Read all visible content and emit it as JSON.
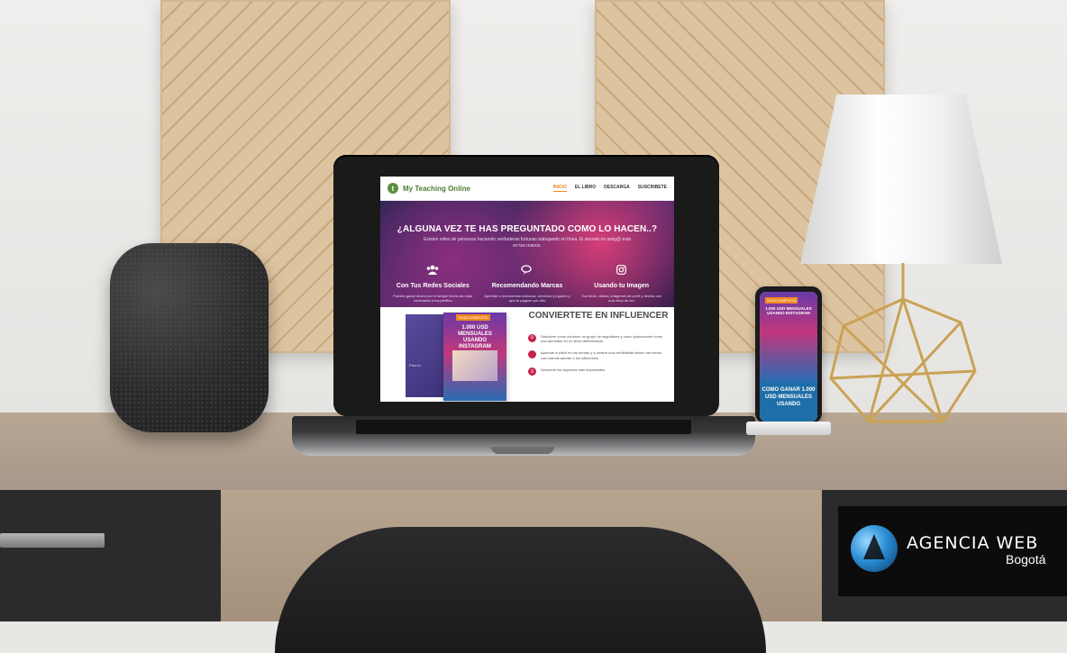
{
  "site": {
    "brand_name": "My Teaching Online",
    "nav": [
      "INICIO",
      "EL LIBRO",
      "DESCARGA",
      "SUSCRIBETE"
    ],
    "hero": {
      "title": "¿ALGUNA VEZ TE HAS PREGUNTADO COMO LO HACEN..?",
      "subtitle": "Existen miles de personas haciendo verdaderas fortunas trabajando en línea. El secreto mi amig@ está en tus manos."
    },
    "features": [
      {
        "icon": "users-icon",
        "title": "Con Tus Redes Sociales",
        "text": "Puedes ganar dinero por el simple hecho de estar conectado a tus perfiles"
      },
      {
        "icon": "chat-icon",
        "title": "Recomendando Marcas",
        "text": "Aprende a recomendar artículos, servicios y lugares y que te paguen por ello"
      },
      {
        "icon": "instagram-icon",
        "title": "Usando tu Imagen",
        "text": "Tus fotos, videos, imágenes de perfil y demás con una mina de oro"
      }
    ],
    "book": {
      "back_text": "Para tu",
      "badge": "GUIA COMPLETA",
      "title": "1.000 USD MENSUALES USANDO INSTAGRAM"
    },
    "section": {
      "title": "CONVIERTETE EN INFLUENCER",
      "bullets": [
        {
          "icon": "U",
          "text": "Descubre como construir un grupo de seguidores y como posicionarte como una autoridad en un tema determinado."
        },
        {
          "icon": "",
          "text": "Aprende a influir en los demás y a crearte una credibilidad dentro del medio. Las marcas adoran a los influencers"
        },
        {
          "icon": "S",
          "text": "Descubre los aspectos más importantes"
        }
      ]
    }
  },
  "phone": {
    "badge": "GUIA COMPLETA",
    "book_title": "1.000 USD MENSUALES USANDO INSTAGRAM",
    "cta": "COMO GANAR 1.000 USD MENSUALES USANDO"
  },
  "agency": {
    "name": "AGENCIA WEB",
    "city": "Bogotá"
  },
  "colors": {
    "accent": "#f08a24",
    "brand_green": "#4e7c2f",
    "bullet_red": "#c7234b"
  }
}
